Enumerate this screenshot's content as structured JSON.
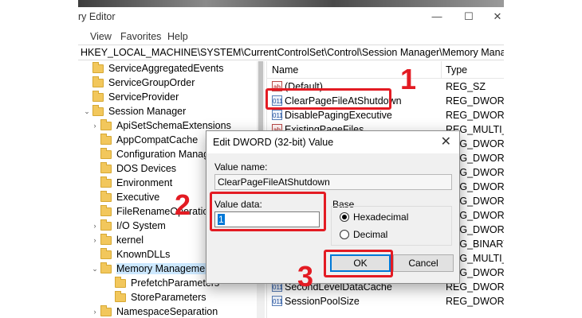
{
  "window": {
    "title": "ry Editor",
    "minimize": "—",
    "maximize": "☐",
    "close": "✕"
  },
  "menu": {
    "items": [
      "View",
      "Favorites",
      "Help"
    ]
  },
  "address": "HKEY_LOCAL_MACHINE\\SYSTEM\\CurrentControlSet\\Control\\Session Manager\\Memory Management",
  "tree": {
    "items": [
      {
        "label": "ServiceAggregatedEvents",
        "level": 0,
        "chevron": ""
      },
      {
        "label": "ServiceGroupOrder",
        "level": 0,
        "chevron": ""
      },
      {
        "label": "ServiceProvider",
        "level": 0,
        "chevron": ""
      },
      {
        "label": "Session Manager",
        "level": 0,
        "chevron": "expanded"
      },
      {
        "label": "ApiSetSchemaExtensions",
        "level": 1,
        "chevron": "collapsed"
      },
      {
        "label": "AppCompatCache",
        "level": 1,
        "chevron": ""
      },
      {
        "label": "Configuration Manager",
        "level": 1,
        "chevron": ""
      },
      {
        "label": "DOS Devices",
        "level": 1,
        "chevron": ""
      },
      {
        "label": "Environment",
        "level": 1,
        "chevron": ""
      },
      {
        "label": "Executive",
        "level": 1,
        "chevron": ""
      },
      {
        "label": "FileRenameOperations",
        "level": 1,
        "chevron": ""
      },
      {
        "label": "I/O System",
        "level": 1,
        "chevron": "collapsed"
      },
      {
        "label": "kernel",
        "level": 1,
        "chevron": "collapsed"
      },
      {
        "label": "KnownDLLs",
        "level": 1,
        "chevron": ""
      },
      {
        "label": "Memory Management",
        "level": 1,
        "chevron": "expanded",
        "selected": true
      },
      {
        "label": "PrefetchParameters",
        "level": 2,
        "chevron": ""
      },
      {
        "label": "StoreParameters",
        "level": 2,
        "chevron": ""
      },
      {
        "label": "NamespaceSeparation",
        "level": 1,
        "chevron": "collapsed"
      }
    ]
  },
  "list": {
    "col_name": "Name",
    "col_type": "Type",
    "rows": [
      {
        "name": "(Default)",
        "type": "REG_SZ",
        "icon": "ab"
      },
      {
        "name": "ClearPageFileAtShutdown",
        "type": "REG_DWORD",
        "icon": "011"
      },
      {
        "name": "DisablePagingExecutive",
        "type": "REG_DWORD",
        "icon": "011"
      },
      {
        "name": "ExistingPageFiles",
        "type": "REG_MULTI_SZ",
        "icon": "ab"
      },
      {
        "name": "",
        "type": "REG_DWORD",
        "icon": ""
      },
      {
        "name": "",
        "type": "REG_DWORD",
        "icon": ""
      },
      {
        "name": "",
        "type": "REG_DWORD",
        "icon": ""
      },
      {
        "name": "",
        "type": "REG_DWORD",
        "icon": ""
      },
      {
        "name": "",
        "type": "REG_DWORD",
        "icon": ""
      },
      {
        "name": "",
        "type": "REG_DWORD",
        "icon": ""
      },
      {
        "name": "",
        "type": "REG_DWORD",
        "icon": ""
      },
      {
        "name": "",
        "type": "REG_BINARY",
        "icon": ""
      },
      {
        "name": "",
        "type": "REG_MULTI_SZ",
        "icon": ""
      },
      {
        "name": "",
        "type": "REG_DWORD",
        "icon": ""
      },
      {
        "name": "SecondLevelDataCache",
        "type": "REG_DWORD",
        "icon": "011"
      },
      {
        "name": "SessionPoolSize",
        "type": "REG_DWORD",
        "icon": "011"
      }
    ]
  },
  "dialog": {
    "title": "Edit DWORD (32-bit) Value",
    "close": "✕",
    "value_name_label": "Value name:",
    "value_name": "ClearPageFileAtShutdown",
    "value_data_label": "Value data:",
    "value_data": "1",
    "base_label": "Base",
    "radio_hex": "Hexadecimal",
    "radio_dec": "Decimal",
    "ok": "OK",
    "cancel": "Cancel"
  },
  "annotations": {
    "step1": "1",
    "step2": "2",
    "step3": "3"
  },
  "colors": {
    "highlight": "#e31b23",
    "selection": "#cce8ff",
    "accent": "#0078d7"
  }
}
